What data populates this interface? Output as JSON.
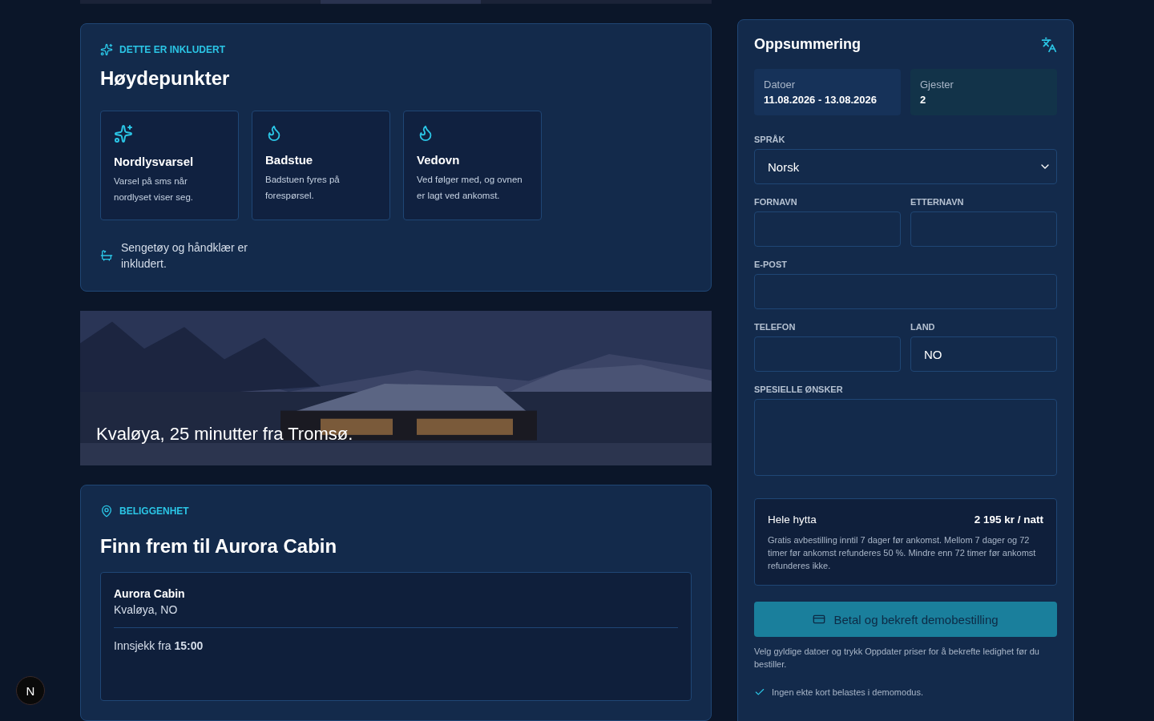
{
  "highlights": {
    "eyebrow": "DETTE ER INKLUDERT",
    "title": "Høydepunkter",
    "cards": [
      {
        "title": "Nordlysvarsel",
        "text": "Varsel på sms når nordlyset viser seg."
      },
      {
        "title": "Badstue",
        "text": "Badstuen fyres på forespørsel."
      },
      {
        "title": "Vedovn",
        "text": "Ved følger med, og ovnen er lagt ved ankomst."
      }
    ],
    "note": "Sengetøy og håndklær er inkludert."
  },
  "photo": {
    "kind": "picture",
    "caption": "Kvaløya, 25 minutter fra Tromsø."
  },
  "location": {
    "eyebrow": "BELIGGENHET",
    "title": "Finn frem til Aurora Cabin",
    "name": "Aurora Cabin",
    "place": "Kvaløya, NO",
    "checkin": "Innsjekk fra **15:00**"
  },
  "summary": {
    "title": "Oppsummering",
    "stats": [
      {
        "label": "Datoer",
        "value": "11.08.2026 - 13.08.2026"
      },
      {
        "label": "Gjester",
        "value": "2"
      }
    ],
    "fields": [
      {
        "kind": "select",
        "label": "SPRÅK",
        "value": "Norsk"
      },
      {
        "kind": "input",
        "label": "FORNAVN"
      },
      {
        "kind": "input",
        "label": "ETTERNAVN"
      },
      {
        "kind": "input",
        "label": "E-POST"
      },
      {
        "kind": "input",
        "label": "TELEFON"
      },
      {
        "kind": "input",
        "label": "LAND",
        "value": "NO"
      },
      {
        "kind": "textarea",
        "label": "SPESIELLE ØNSKER"
      }
    ],
    "price": {
      "name": "Hele hytta",
      "amount": "2 195 kr / natt",
      "terms": "Gratis avbestilling inntil 7 dager før ankomst. Mellom 7 dager og 72 timer før ankomst refunderes 50 %. Mindre enn 72 timer før ankomst refunderes ikke."
    },
    "button": "Betal og bekreft demobestilling",
    "hint": "Velg gyldige datoer og trykk Oppdater priser for å bekrefte ledighet før du bestiller.",
    "assurance": "Ingen ekte kort belastes i demomodus."
  },
  "dev_badge": "N"
}
